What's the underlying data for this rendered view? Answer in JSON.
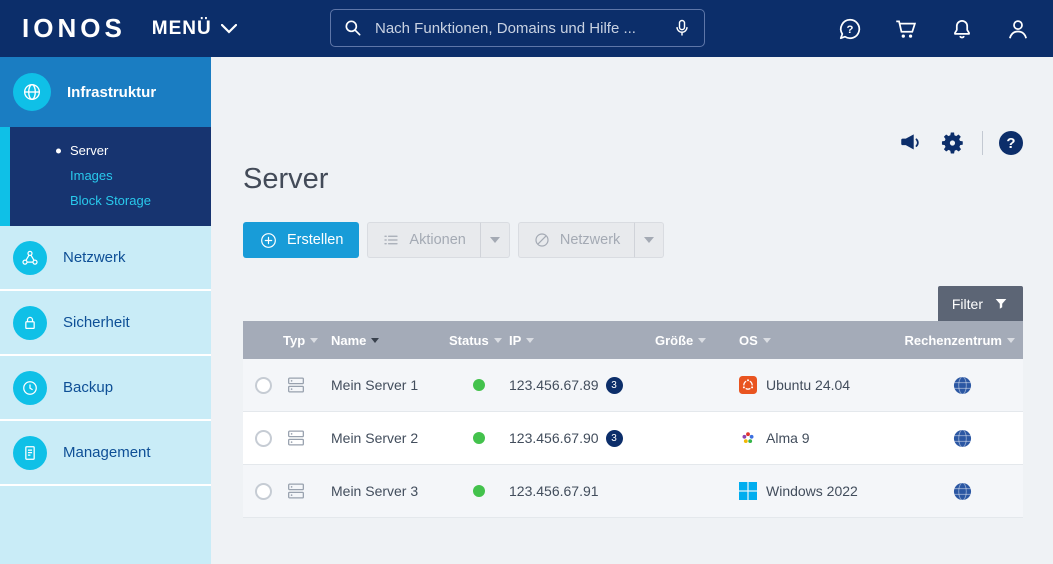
{
  "header": {
    "logo": "IONOS",
    "menu": "MENÜ",
    "search_placeholder": "Nach Funktionen, Domains und Hilfe ...",
    "icons": [
      "help-chat-icon",
      "cart-icon",
      "notifications-icon",
      "account-icon"
    ]
  },
  "glyphs": {
    "question": "?"
  },
  "sidebar": {
    "active": {
      "label": "Infrastruktur",
      "icon": "infrastructure-icon"
    },
    "submenu": [
      {
        "label": "Server",
        "active": true
      },
      {
        "label": "Images",
        "active": false
      },
      {
        "label": "Block Storage",
        "active": false
      }
    ],
    "items": [
      {
        "label": "Netzwerk",
        "icon": "network-icon"
      },
      {
        "label": "Sicherheit",
        "icon": "security-icon"
      },
      {
        "label": "Backup",
        "icon": "backup-icon"
      },
      {
        "label": "Management",
        "icon": "management-icon"
      }
    ]
  },
  "main": {
    "title": "Server",
    "toolbar": {
      "create": "Erstellen",
      "actions": "Aktionen",
      "network": "Netzwerk"
    },
    "filter": "Filter",
    "table": {
      "columns": [
        {
          "label": "Typ",
          "sorted": false
        },
        {
          "label": "Name",
          "sorted": true
        },
        {
          "label": "Status",
          "sorted": false
        },
        {
          "label": "IP",
          "sorted": false
        },
        {
          "label": "Größe",
          "sorted": false
        },
        {
          "label": "OS",
          "sorted": false
        },
        {
          "label": "Rechenzentrum",
          "sorted": false
        }
      ],
      "rows": [
        {
          "name": "Mein Server 1",
          "status": "running",
          "ip": "123.456.67.89",
          "ip_badge": "3",
          "size": "",
          "os": {
            "label": "Ubuntu 24.04",
            "icon": "ubuntu-icon"
          },
          "datacenter": "globe-icon"
        },
        {
          "name": "Mein Server 2",
          "status": "running",
          "ip": "123.456.67.90",
          "ip_badge": "3",
          "size": "",
          "os": {
            "label": "Alma 9",
            "icon": "almalinux-icon"
          },
          "datacenter": "globe-icon"
        },
        {
          "name": "Mein Server 3",
          "status": "running",
          "ip": "123.456.67.91",
          "ip_badge": "",
          "size": "",
          "os": {
            "label": "Windows 2022",
            "icon": "windows-icon"
          },
          "datacenter": "globe-icon"
        }
      ]
    }
  },
  "colors": {
    "header_bg": "#0c2e6a",
    "accent_teal": "#0fc0e7",
    "active_item_bg": "#1a7dc2",
    "submenu_bg": "#173470",
    "sidebar_bg": "#c9ecf7",
    "primary_button_bg": "#189cd8",
    "filter_button_bg": "#5c6575",
    "table_header_bg": "#a4abb8",
    "status_green": "#43c24c"
  }
}
